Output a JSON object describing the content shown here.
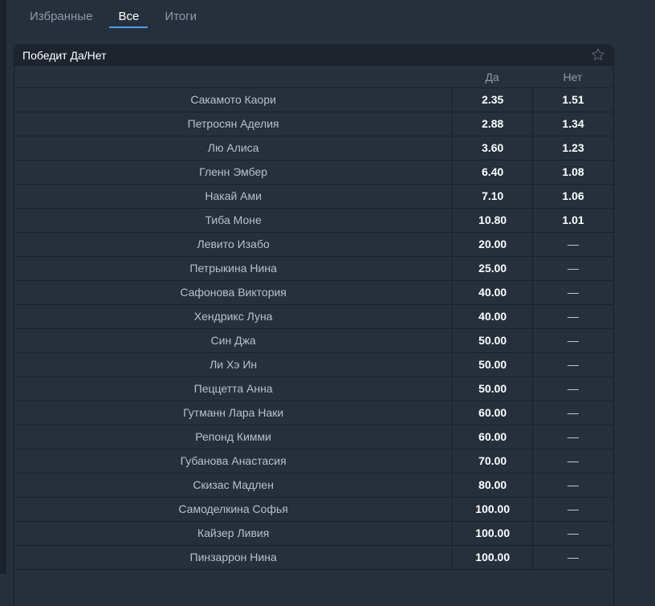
{
  "tabs": [
    {
      "label": "Избранные"
    },
    {
      "label": "Все",
      "active": true
    },
    {
      "label": "Итоги"
    }
  ],
  "market": {
    "title": "Победит Да/Нет",
    "columns": {
      "yes": "Да",
      "no": "Нет"
    },
    "rows": [
      {
        "name": "Сакамото Каори",
        "yes": "2.35",
        "no": "1.51"
      },
      {
        "name": "Петросян Аделия",
        "yes": "2.88",
        "no": "1.34"
      },
      {
        "name": "Лю Алиса",
        "yes": "3.60",
        "no": "1.23"
      },
      {
        "name": "Гленн Эмбер",
        "yes": "6.40",
        "no": "1.08"
      },
      {
        "name": "Накай Ами",
        "yes": "7.10",
        "no": "1.06"
      },
      {
        "name": "Тиба Моне",
        "yes": "10.80",
        "no": "1.01"
      },
      {
        "name": "Левито Изабо",
        "yes": "20.00",
        "no": "—"
      },
      {
        "name": "Петрыкина Нина",
        "yes": "25.00",
        "no": "—"
      },
      {
        "name": "Сафонова Виктория",
        "yes": "40.00",
        "no": "—"
      },
      {
        "name": "Хендрикс Луна",
        "yes": "40.00",
        "no": "—"
      },
      {
        "name": "Син Джа",
        "yes": "50.00",
        "no": "—"
      },
      {
        "name": "Ли Хэ Ин",
        "yes": "50.00",
        "no": "—"
      },
      {
        "name": "Пеццетта Анна",
        "yes": "50.00",
        "no": "—"
      },
      {
        "name": "Гутманн Лара Наки",
        "yes": "60.00",
        "no": "—"
      },
      {
        "name": "Репонд Кимми",
        "yes": "60.00",
        "no": "—"
      },
      {
        "name": "Губанова Анастасия",
        "yes": "70.00",
        "no": "—"
      },
      {
        "name": "Скизас Мадлен",
        "yes": "80.00",
        "no": "—"
      },
      {
        "name": "Самоделкина Софья",
        "yes": "100.00",
        "no": "—"
      },
      {
        "name": "Кайзер Ливия",
        "yes": "100.00",
        "no": "—"
      },
      {
        "name": "Пинзаррон Нина",
        "yes": "100.00",
        "no": "—"
      }
    ]
  }
}
